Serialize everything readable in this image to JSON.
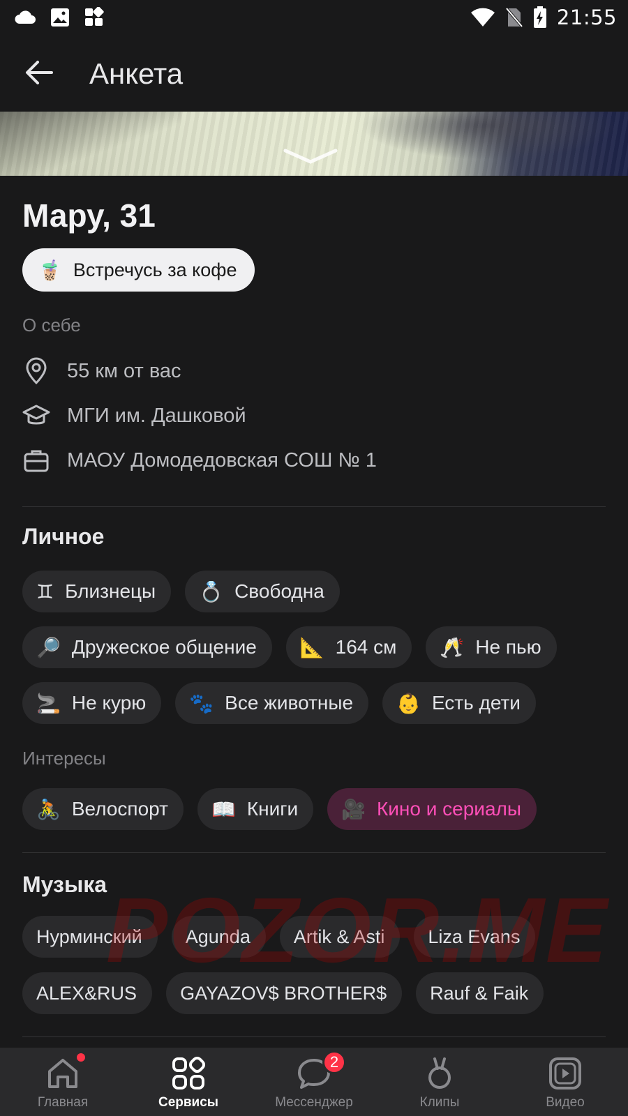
{
  "status_bar": {
    "time": "21:55"
  },
  "header": {
    "title": "Анкета"
  },
  "profile": {
    "name_age": "Мару, 31",
    "goal": {
      "emoji": "🧋",
      "label": "Встречусь за кофе"
    },
    "about_label": "О себе",
    "info": [
      {
        "icon": "location-pin-icon",
        "text": "55 км от вас"
      },
      {
        "icon": "graduation-cap-icon",
        "text": "МГИ им. Дашковой"
      },
      {
        "icon": "briefcase-icon",
        "text": "МАОУ Домодедовская СОШ № 1"
      }
    ]
  },
  "personal": {
    "title": "Личное",
    "chips": [
      {
        "emoji": "♊",
        "label": "Близнецы"
      },
      {
        "emoji": "💍",
        "label": "Свободна"
      },
      {
        "emoji": "🔎",
        "label": "Дружеское общение"
      },
      {
        "emoji": "📐",
        "label": "164 см"
      },
      {
        "emoji": "🥂",
        "label": "Не пью"
      },
      {
        "emoji": "🚬",
        "label": "Не курю"
      },
      {
        "emoji": "🐾",
        "label": "Все животные"
      },
      {
        "emoji": "👶",
        "label": "Есть дети"
      }
    ]
  },
  "interests": {
    "title": "Интересы",
    "chips": [
      {
        "emoji": "🚴",
        "label": "Велоспорт"
      },
      {
        "emoji": "📖",
        "label": "Книги"
      },
      {
        "emoji": "🎥",
        "label": "Кино и сериалы"
      }
    ]
  },
  "music": {
    "title": "Музыка",
    "chips": [
      "Нурминский",
      "Agunda",
      "Artik & Asti",
      "Liza Evans",
      "ALEX&RUS",
      "GAYAZOV$ BROTHER$",
      "Rauf & Faik"
    ]
  },
  "watermark": "POZOR.ME",
  "bottom_nav": {
    "items": [
      {
        "label": "Главная"
      },
      {
        "label": "Сервисы"
      },
      {
        "label": "Мессенджер",
        "badge": "2"
      },
      {
        "label": "Клипы"
      },
      {
        "label": "Видео"
      }
    ]
  },
  "colors": {
    "background": "#19191a",
    "chip": "#2a2a2c",
    "highlight_text": "#ff4fb8",
    "badge": "#ff3347"
  }
}
